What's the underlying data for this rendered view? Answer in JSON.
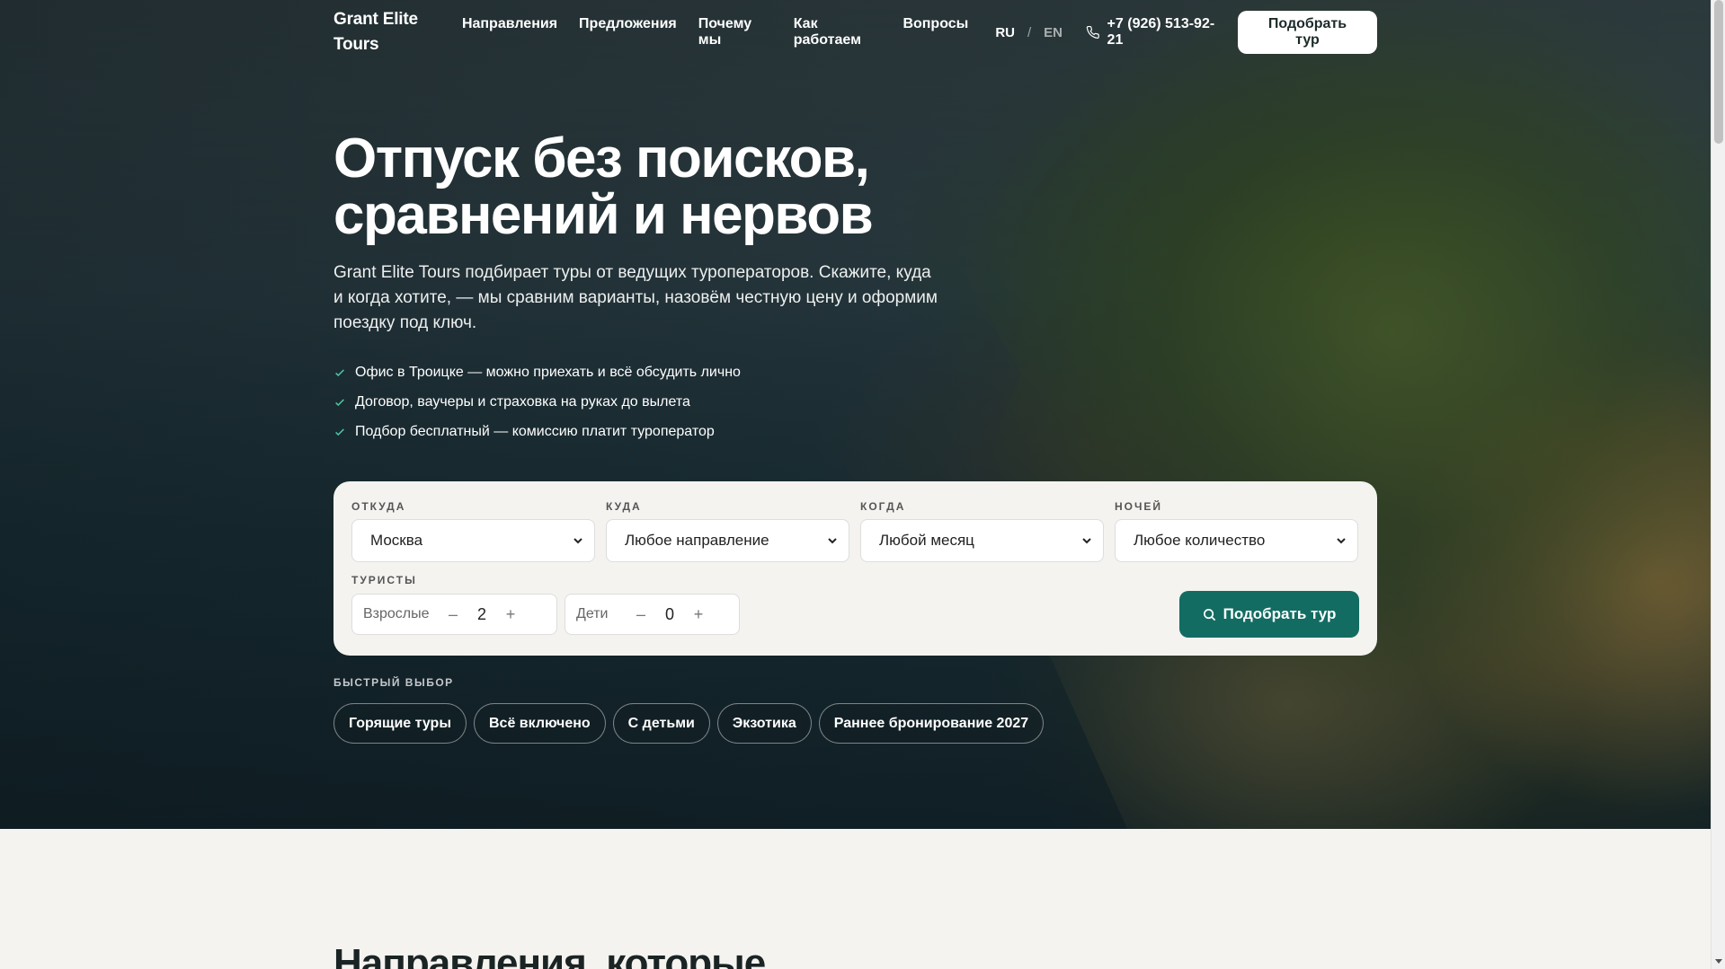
{
  "header": {
    "logo": "Grant Elite Tours",
    "nav": [
      "Направления",
      "Предложения",
      "Почему мы",
      "Как работаем",
      "Вопросы"
    ],
    "lang_active": "RU",
    "lang_sep": "/",
    "lang_other": "EN",
    "phone": "+7 (926) 513-92-21",
    "cta": "Подобрать тур"
  },
  "hero": {
    "title": "Отпуск без поисков, сравнений и нервов",
    "subtitle": "Grant Elite Tours подбирает туры от ведущих туроператоров. Скажите, куда и когда хотите, — мы сравним варианты, назовём честную цену и оформим поездку под ключ.",
    "features": [
      "Офис в Троицке — можно приехать и всё обсудить лично",
      "Договор, ваучеры и страховка на руках до вылета",
      "Подбор бесплатный — комиссию платит туроператор"
    ]
  },
  "search": {
    "fields": [
      {
        "label": "ОТКУДА",
        "value": "Москва"
      },
      {
        "label": "КУДА",
        "value": "Любое направление"
      },
      {
        "label": "КОГДА",
        "value": "Любой месяц"
      },
      {
        "label": "НОЧЕЙ",
        "value": "Любое количество"
      }
    ],
    "tourists_label": "ТУРИСТЫ",
    "adults_label": "Взрослые",
    "adults_value": "2",
    "kids_label": "Дети",
    "kids_value": "0",
    "minus": "–",
    "plus": "+",
    "submit": "Подобрать тур"
  },
  "quick": {
    "label": "БЫСТРЫЙ ВЫБОР",
    "chips": [
      "Горящие туры",
      "Всё включено",
      "С детьми",
      "Экзотика",
      "Раннее бронирование 2027"
    ]
  },
  "next_section": {
    "title": "Направления, которые"
  },
  "colors": {
    "accent": "#136c62",
    "check": "#4fc3a1"
  }
}
